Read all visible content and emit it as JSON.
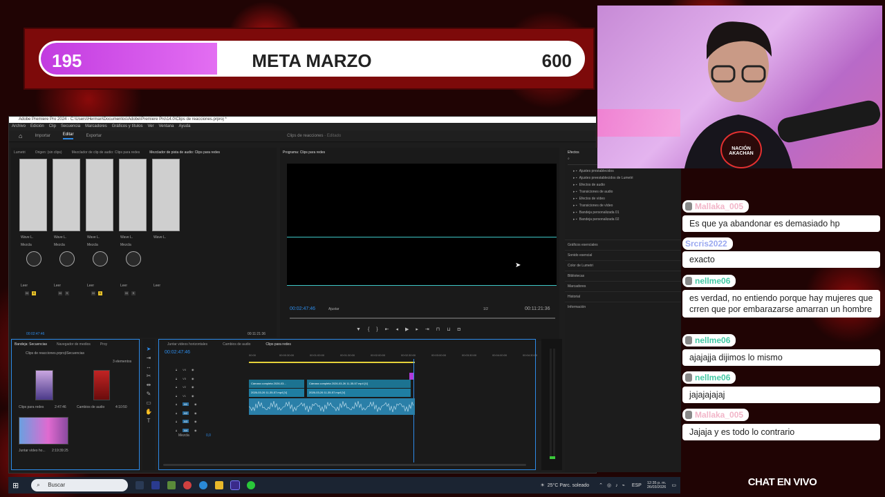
{
  "goal": {
    "current": "195",
    "title": "META MARZO",
    "max": "600",
    "progress_fraction": 0.325
  },
  "premiere": {
    "title": "Adobe Premiere Pro 2024 - C:\\Users\\Herman\\Documentos\\Adobe\\Premiere Pro\\14.0\\Clips de reacciones.prproj *",
    "menu": [
      "Archivo",
      "Edición",
      "Clip",
      "Secuencia",
      "Marcadores",
      "Gráficos y títulos",
      "Ver",
      "Ventana",
      "Ayuda"
    ],
    "workspaces": [
      "Importar",
      "Editar",
      "Exportar"
    ],
    "project_title": "Clips de reacciones",
    "project_status": "Editado",
    "mixer_tabs": [
      "Lumetri",
      "Origen: (sin clips)",
      "Mezclador de clip de audio: Clips para redes",
      "Mezclador de pista de audio: Clips para redes"
    ],
    "program_tab": "Programa: Clips para redes",
    "effects_tab": "Efectos",
    "program_timecode": "00:02:47:46",
    "program_fit": "Ajustar",
    "program_quality": "1/2",
    "program_duration": "00:11:21:36",
    "mixer_timecode": "00:02:47:46",
    "mixer_duration": "00:11:21:36",
    "mixer_channel_label": "Wave L.",
    "mixer_mode": "Mezcla",
    "mixer_read": "Leer",
    "effects_items": [
      "Ajustes prestablecidos",
      "Ajustes preestablecidos de Lumetri",
      "Efectos de audio",
      "Transiciones de audio",
      "Efectos de vídeo",
      "Transiciones de vídeo",
      "Bandeja personalizada 01",
      "Bandeja personalizada 02"
    ],
    "effects_sections": [
      "Gráficos esenciales",
      "Sonido esencial",
      "Color de Lumetri",
      "Bibliotecas",
      "Marcadores",
      "Historial",
      "Información"
    ],
    "project_tabs": [
      "Bandeja: Secuencias",
      "Navegador de medios",
      "Proy"
    ],
    "project_path": "Clips de reacciones.prproj\\Secuencias",
    "project_count": "3 elementos",
    "project_items": [
      {
        "name": "Clips para redes",
        "duration": "2:47:46"
      },
      {
        "name": "Cambios de audio",
        "duration": "4:10:50"
      },
      {
        "name": "Juntar vídeo ho...",
        "duration": "2:19:39:25"
      }
    ],
    "timeline_tabs": [
      "Juntar videos horizontales",
      "Cambios de audio",
      "Clips para redes"
    ],
    "timeline_timecode": "00:02:47:46",
    "timeline_ruler": [
      "00:00",
      "00:00:30:00",
      "00:01:00:00",
      "00:01:30:00",
      "00:02:00:00",
      "00:02:30:00",
      "00:03:00:00",
      "00:03:30:00",
      "00:04:00:00",
      "00:04:30:00"
    ],
    "tracks_video": [
      "V4",
      "V3",
      "V2",
      "V1"
    ],
    "tracks_audio": [
      "A1",
      "A2",
      "A3",
      "A4"
    ],
    "mix_label": "Mezcla",
    "mix_value": "0,0",
    "clips_video": [
      "Cámara completa 2026-03...",
      "Cámara completa 2026-03-26 11-35-57.mp4 [V]"
    ],
    "clips_v1": [
      "2026-03-26 11-35-57.mp4 [V]",
      "2026-03-26 11-35-57.mp4 [V]"
    ]
  },
  "chat": {
    "live_label": "CHAT EN VIVO",
    "messages": [
      {
        "user": "Mallaka_005",
        "text": "Es que ya abandonar es demasiado hp",
        "user_color": "#f2b5c8",
        "badge": true
      },
      {
        "user": "Srcris2022",
        "text": "exacto",
        "user_color": "#9aa8f0",
        "badge": false
      },
      {
        "user": "nellme06",
        "text": "es verdad, no entiendo porque hay mujeres que crren que por embarazarse amarran un hombre",
        "user_color": "#43c9a4",
        "badge": true
      },
      {
        "user": "nellme06",
        "text": "ajajajja dijimos lo mismo",
        "user_color": "#43c9a4",
        "badge": true
      },
      {
        "user": "nellme06",
        "text": "jajajajajaj",
        "user_color": "#43c9a4",
        "badge": true
      },
      {
        "user": "Mallaka_005",
        "text": "Jajaja y es todo lo contrario",
        "user_color": "#f2b5c8",
        "badge": true
      }
    ]
  },
  "webcam": {
    "overlay_text": "NACIÓN AKACHAN"
  },
  "taskbar": {
    "search_placeholder": "Buscar",
    "weather": "25°C  Parc. soleado",
    "lang": "ESP",
    "time": "12:35 p. m.",
    "date": "26/03/2026"
  },
  "colors": {
    "accent": "#2d8ceb",
    "goal_fill": "#d24fe8",
    "frame_red": "#7d0a0a"
  }
}
